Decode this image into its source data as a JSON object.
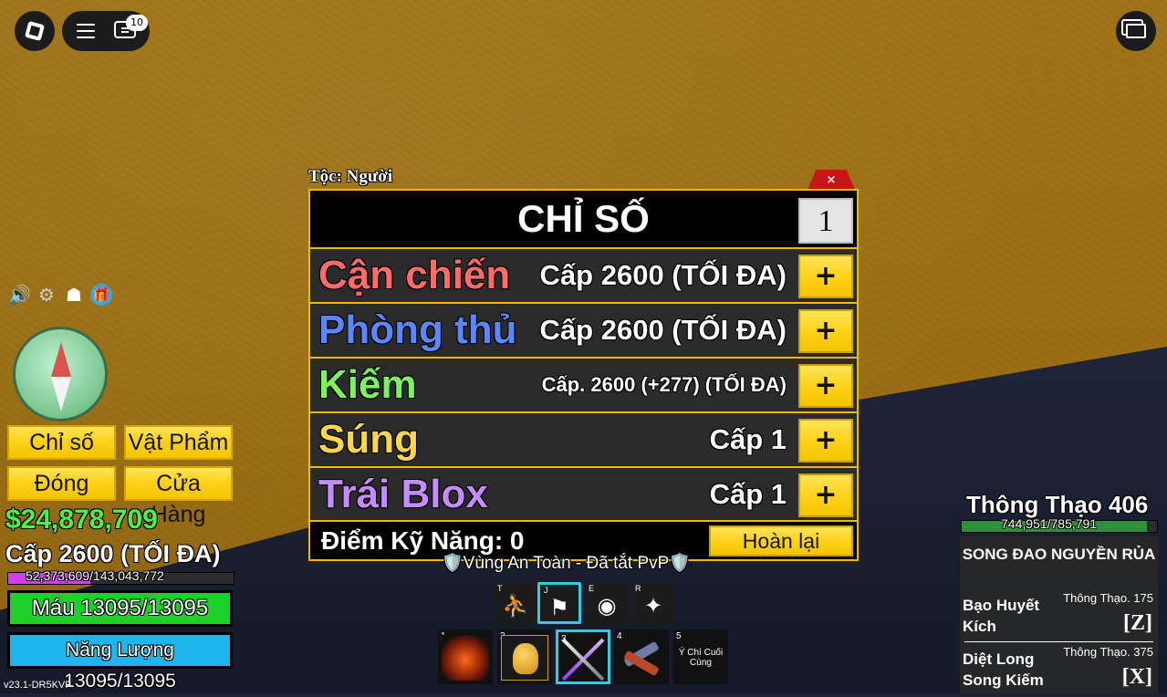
{
  "topbar": {
    "notifications": "10"
  },
  "stats_panel": {
    "race_label": "Tộc: Người",
    "close_label": "×",
    "title": "CHỈ SỐ",
    "point_amount": "1",
    "rows": [
      {
        "name": "Cận chiến",
        "value": "Cấp 2600 (TỐI ĐA)",
        "color": "#ff6b6b"
      },
      {
        "name": "Phòng thủ",
        "value": "Cấp 2600 (TỐI ĐA)",
        "color": "#5c86ff"
      },
      {
        "name": "Kiếm",
        "value": "Cấp. 2600 (+277) (TỐI ĐA)",
        "color": "#7cf25c"
      },
      {
        "name": "Súng",
        "value": "Cấp 1",
        "color": "#ffd54a"
      },
      {
        "name": "Trái Blox",
        "value": "Cấp 1",
        "color": "#c58bff"
      }
    ],
    "plus_label": "+",
    "skill_points": "Điểm Kỹ Năng: 0",
    "reset_label": "Hoàn lại"
  },
  "left_menu": {
    "stats": "Chỉ số",
    "items": "Vật Phẩm",
    "close": "Đóng",
    "shop": "Cửa Hàng"
  },
  "player": {
    "money": "$24,878,709",
    "level": "Cấp 2600 (TỐI ĐA)",
    "xp_text": "52,373,609/143,043,772",
    "xp_fraction": 0.366,
    "health": "Máu 13095/13095",
    "energy": "Năng Lượng 13095/13095"
  },
  "version": "v23.1-DR5KVF",
  "zone_label": "🛡️Vùng An Toàn - Đã tắt PvP🛡️",
  "hotkeys": [
    {
      "key": "T",
      "icon": "strength-icon"
    },
    {
      "key": "J",
      "icon": "ability-icon"
    },
    {
      "key": "E",
      "icon": "eye-icon"
    },
    {
      "key": "R",
      "icon": "wing-icon"
    }
  ],
  "inventory": [
    {
      "key": "1"
    },
    {
      "key": "2"
    },
    {
      "key": "3"
    },
    {
      "key": "4"
    },
    {
      "key": "5",
      "label": "Ý Chí Cuối Cùng"
    }
  ],
  "mastery": {
    "title": "Thông Thạo 406",
    "progress_text": "744,951/785,791",
    "fraction": 0.948,
    "weapon_name": "SONG ĐAO NGUYỀN RỦA",
    "moves": [
      {
        "name": "Bạo Huyết Kích",
        "req": "Thông Thạo. 175",
        "key": "[Z]"
      },
      {
        "name": "Diệt Long Song Kiếm",
        "req": "Thông Thạo. 375",
        "key": "[X]"
      }
    ]
  }
}
